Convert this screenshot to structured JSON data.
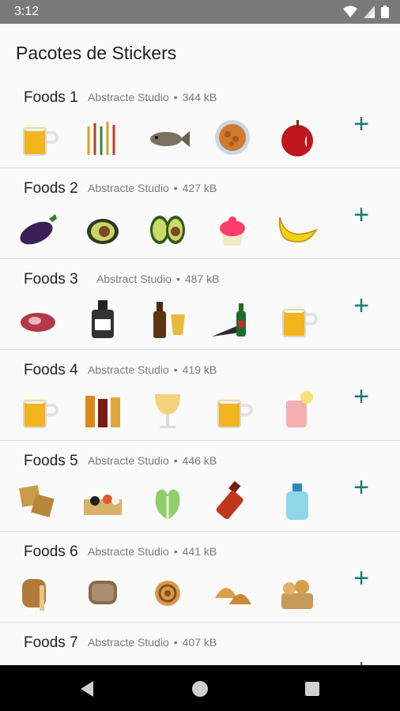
{
  "status": {
    "time": "3:12"
  },
  "app": {
    "title": "Pacotes de Stickers"
  },
  "packs": [
    {
      "name": "Foods 1",
      "author": "Abstracte Studio",
      "size": "344 kB",
      "add": "+",
      "stickers": [
        "beer-mug-icon",
        "candles-icon",
        "fish-icon",
        "peanuts-bowl-icon",
        "apple-icon"
      ]
    },
    {
      "name": "Foods 2",
      "author": "Abstracte Studio",
      "size": "427 kB",
      "add": "+",
      "stickers": [
        "eggplant-icon",
        "avocado-half-icon",
        "avocado-pair-icon",
        "cupcake-icon",
        "banana-icon"
      ]
    },
    {
      "name": "Foods 3",
      "author": "Abstract Studio",
      "size": "487 kB",
      "add": "+",
      "stickers": [
        "raw-meat-icon",
        "whisky-bottle-icon",
        "beer-bottle-glass-icon",
        "green-bottle-icon",
        "beer-mug-icon"
      ]
    },
    {
      "name": "Foods 4",
      "author": "Abstracte Studio",
      "size": "419 kB",
      "add": "+",
      "stickers": [
        "beer-mug-icon",
        "beer-glasses-icon",
        "wine-glass-icon",
        "beer-mug-icon",
        "cocktail-icon"
      ]
    },
    {
      "name": "Foods 5",
      "author": "Abstracte Studio",
      "size": "446 kB",
      "add": "+",
      "stickers": [
        "crackers-icon",
        "sushi-board-icon",
        "lettuce-icon",
        "hot-sauce-icon",
        "water-jug-icon"
      ]
    },
    {
      "name": "Foods 6",
      "author": "Abstracte Studio",
      "size": "441 kB",
      "add": "+",
      "stickers": [
        "bread-loaf-icon",
        "bread-slice-icon",
        "cinnamon-roll-icon",
        "croissants-icon",
        "pastry-basket-icon"
      ]
    },
    {
      "name": "Foods 7",
      "author": "Abstracte Studio",
      "size": "407 kB",
      "add": "+",
      "stickers": []
    }
  ],
  "colors": {
    "accent": "#1c7b6d",
    "status_bar": "#7a7a7a",
    "nav_bar": "#000000"
  }
}
